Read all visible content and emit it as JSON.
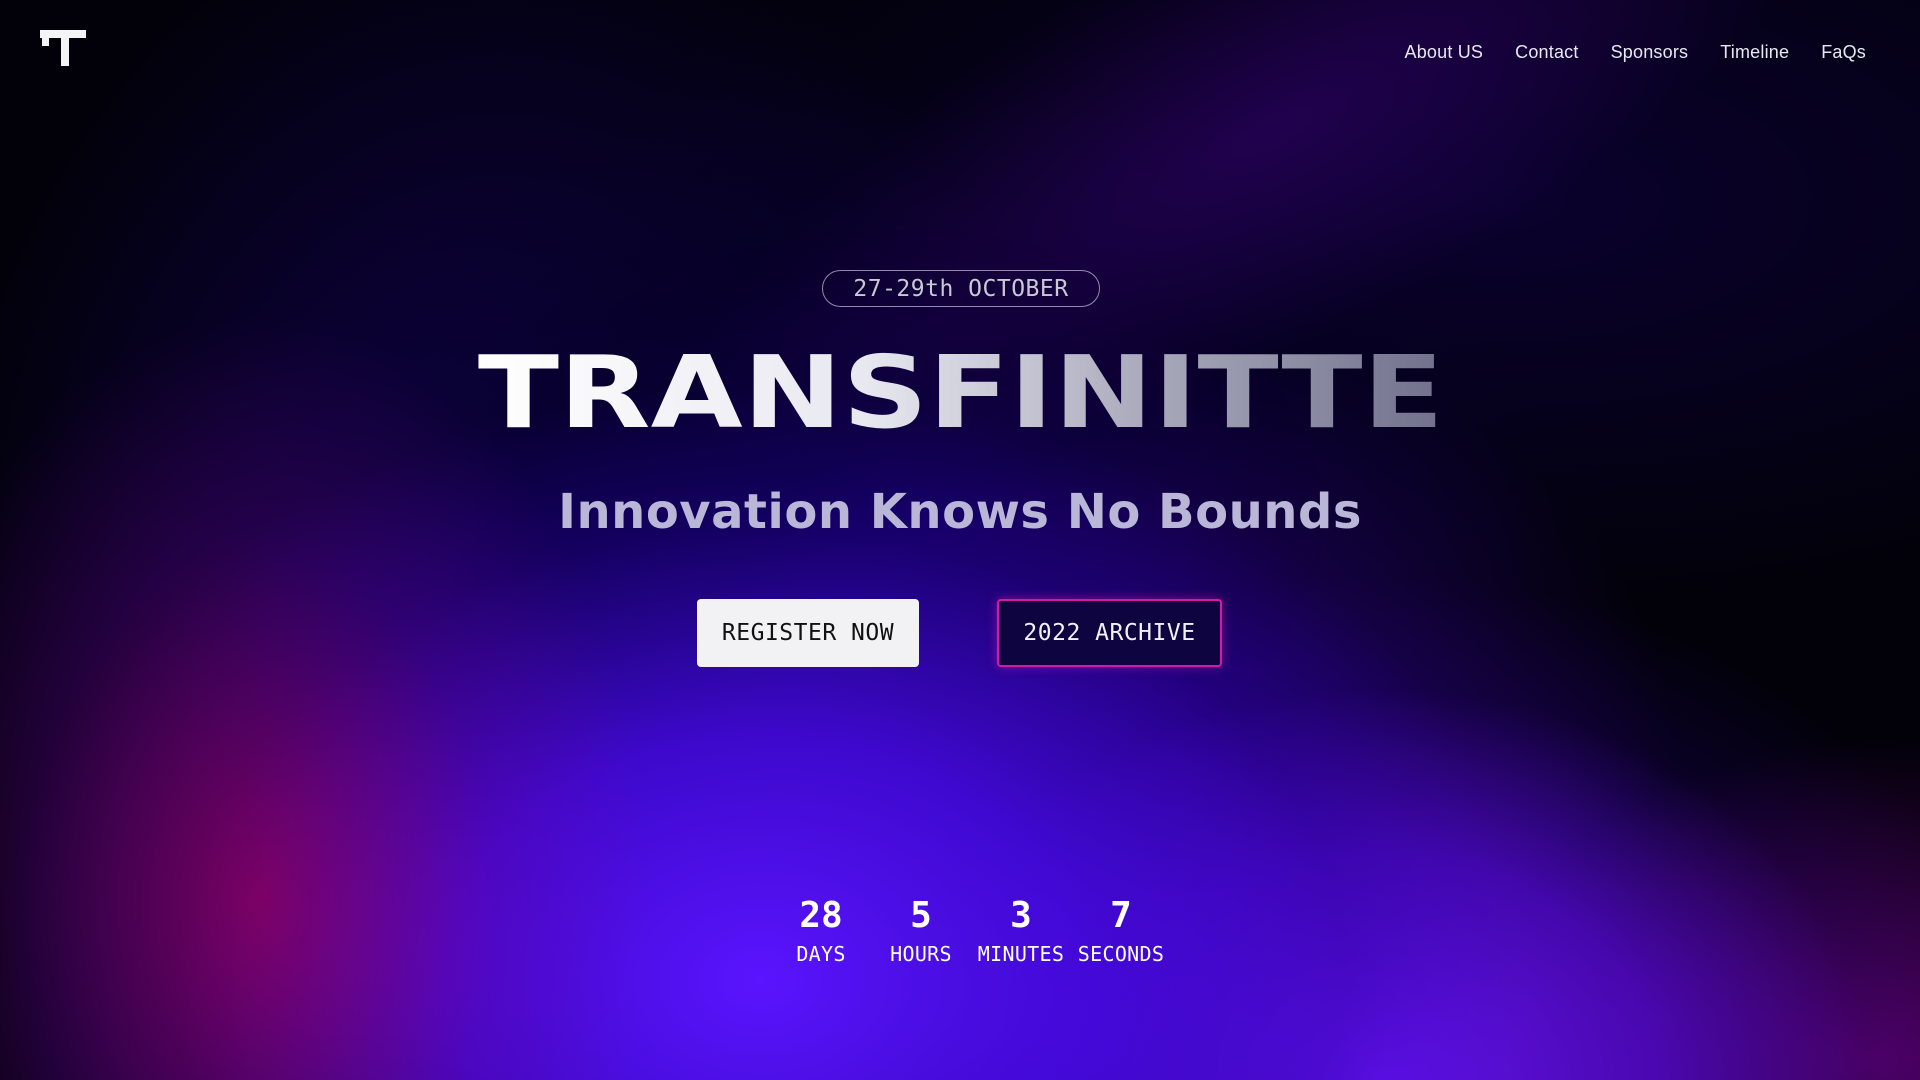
{
  "header": {
    "logo_icon": "transfinitte-logo-icon",
    "nav": [
      {
        "label": "About US"
      },
      {
        "label": "Contact"
      },
      {
        "label": "Sponsors"
      },
      {
        "label": "Timeline"
      },
      {
        "label": "FaQs"
      }
    ]
  },
  "hero": {
    "date": "27-29th OCTOBER",
    "title": "TRANSFINITTE",
    "tagline": "Innovation Knows No Bounds",
    "register_label": "REGISTER NOW",
    "archive_label": "2022 ARCHIVE"
  },
  "countdown": [
    {
      "value": "28",
      "label": "DAYS"
    },
    {
      "value": "5",
      "label": "HOURS"
    },
    {
      "value": "3",
      "label": "MINUTES"
    },
    {
      "value": "7",
      "label": "SECONDS"
    }
  ],
  "colors": {
    "background": "#02010a",
    "accent_purple": "#5a14ff",
    "archive_border": "#d21aa8",
    "register_bg": "#f2f2f4"
  }
}
